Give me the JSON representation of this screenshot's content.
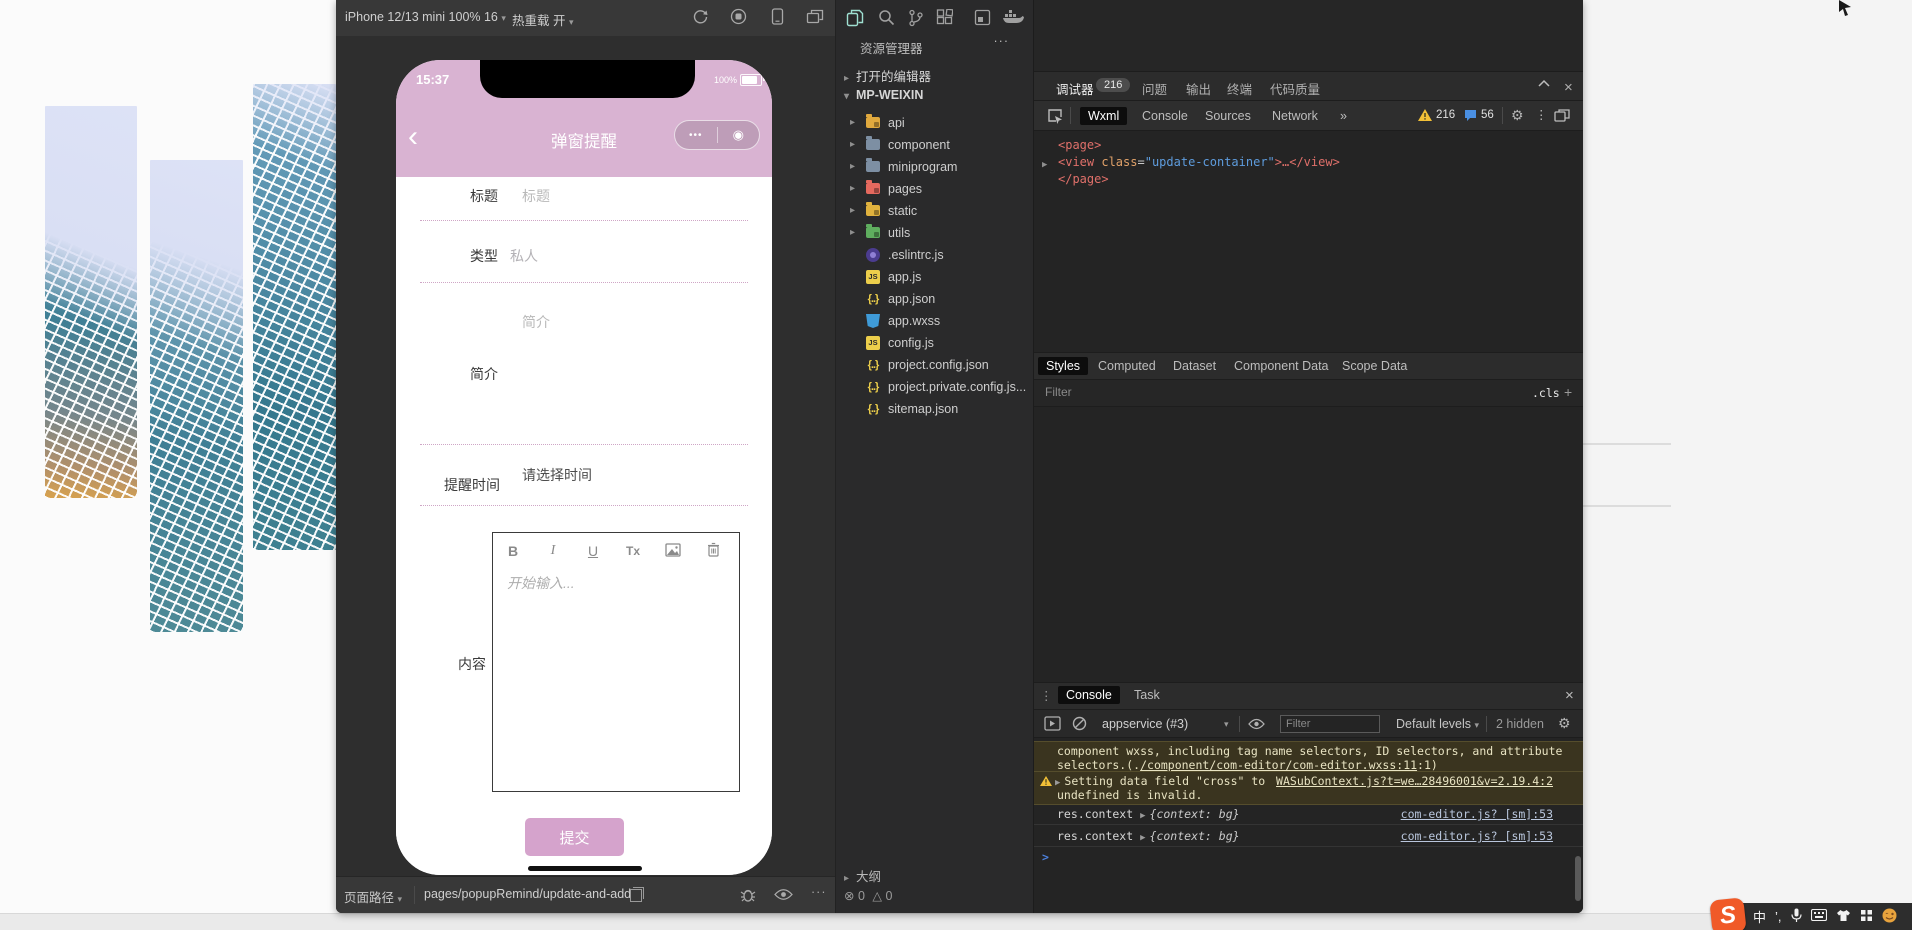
{
  "device_bar": {
    "device_label": "iPhone 12/13 mini 100% 16",
    "hot_reload_label": "热重载 开"
  },
  "simulator": {
    "status_time": "15:37",
    "battery_percent": "100%",
    "nav_title": "弹窗提醒",
    "capsule_dots": "•••",
    "capsule_circle": "◉",
    "form": {
      "title_label": "标题",
      "title_placeholder": "标题",
      "type_label": "类型",
      "type_value": "私人",
      "intro_placeholder": "简介",
      "intro_label": "简介",
      "remind_label": "提醒时间",
      "remind_value": "请选择时间",
      "content_label": "内容",
      "editor": {
        "bold": "B",
        "italic": "I",
        "underline": "U",
        "clear_format": "Tx",
        "placeholder": "开始输入..."
      },
      "submit_label": "提交"
    }
  },
  "sim_bottom": {
    "path_label": "页面路径",
    "path_value": "pages/popupRemind/update-and-add"
  },
  "explorer": {
    "title": "资源管理器",
    "more": "···",
    "open_editors_label": "打开的编辑器",
    "project_name": "MP-WEIXIN",
    "files": [
      {
        "name": "api"
      },
      {
        "name": "component"
      },
      {
        "name": "miniprogram"
      },
      {
        "name": "pages"
      },
      {
        "name": "static"
      },
      {
        "name": "utils"
      },
      {
        "name": ".eslintrc.js"
      },
      {
        "name": "app.js"
      },
      {
        "name": "app.json"
      },
      {
        "name": "app.wxss"
      },
      {
        "name": "config.js"
      },
      {
        "name": "project.config.json"
      },
      {
        "name": "project.private.config.js..."
      },
      {
        "name": "sitemap.json"
      }
    ],
    "outline_label": "大纲",
    "error_count": "0",
    "warning_count": "0"
  },
  "dbg": {
    "tabs": {
      "debugger": "调试器",
      "badge": "216",
      "problems": "问题",
      "output": "输出",
      "terminal": "终端",
      "quality": "代码质量"
    },
    "subtabs": {
      "wxml": "Wxml",
      "console": "Console",
      "sources": "Sources",
      "network": "Network",
      "more": "»"
    },
    "warn_count": "216",
    "info_count": "56",
    "wxml_tree": {
      "open_tag": "<page>",
      "view_tag": "<view",
      "attr_name": "class",
      "attr_eq": "=",
      "attr_value": "\"update-container\"",
      "view_rest": ">…</view>",
      "close_tag": "</page>"
    },
    "styles_tabs": [
      "Styles",
      "Computed",
      "Dataset",
      "Component Data",
      "Scope Data"
    ],
    "styles_filter_placeholder": "Filter",
    "cls_label": ".cls",
    "add_label": "+",
    "console": {
      "tab_console": "Console",
      "tab_task": "Task",
      "context_selector": "appservice (#3)",
      "filter_placeholder": "Filter",
      "levels_label": "Default levels",
      "hidden_label": "2 hidden",
      "warn1_line1": "component wxss, including tag name selectors, ID selectors, and attribute",
      "warn1_pre": "selectors.(.",
      "warn1_link": "/component/com-editor/com-editor.wxss:11",
      "warn1_post": ":1)",
      "warn2_text1": "Setting data field \"cross\" to",
      "warn2_text2": "undefined is invalid.",
      "warn2_link": "WASubContext.js?t=we…28496001&v=2.19.4:2",
      "log1_expr": "res.context",
      "log1_preview": "{context: bg}",
      "log1_link": "com-editor.js? [sm]:53",
      "log2_expr": "res.context",
      "log2_preview": "{context: bg}",
      "log2_link": "com-editor.js? [sm]:53",
      "prompt": ">"
    }
  },
  "ime": {
    "lang": "中",
    "punct": "’,"
  }
}
